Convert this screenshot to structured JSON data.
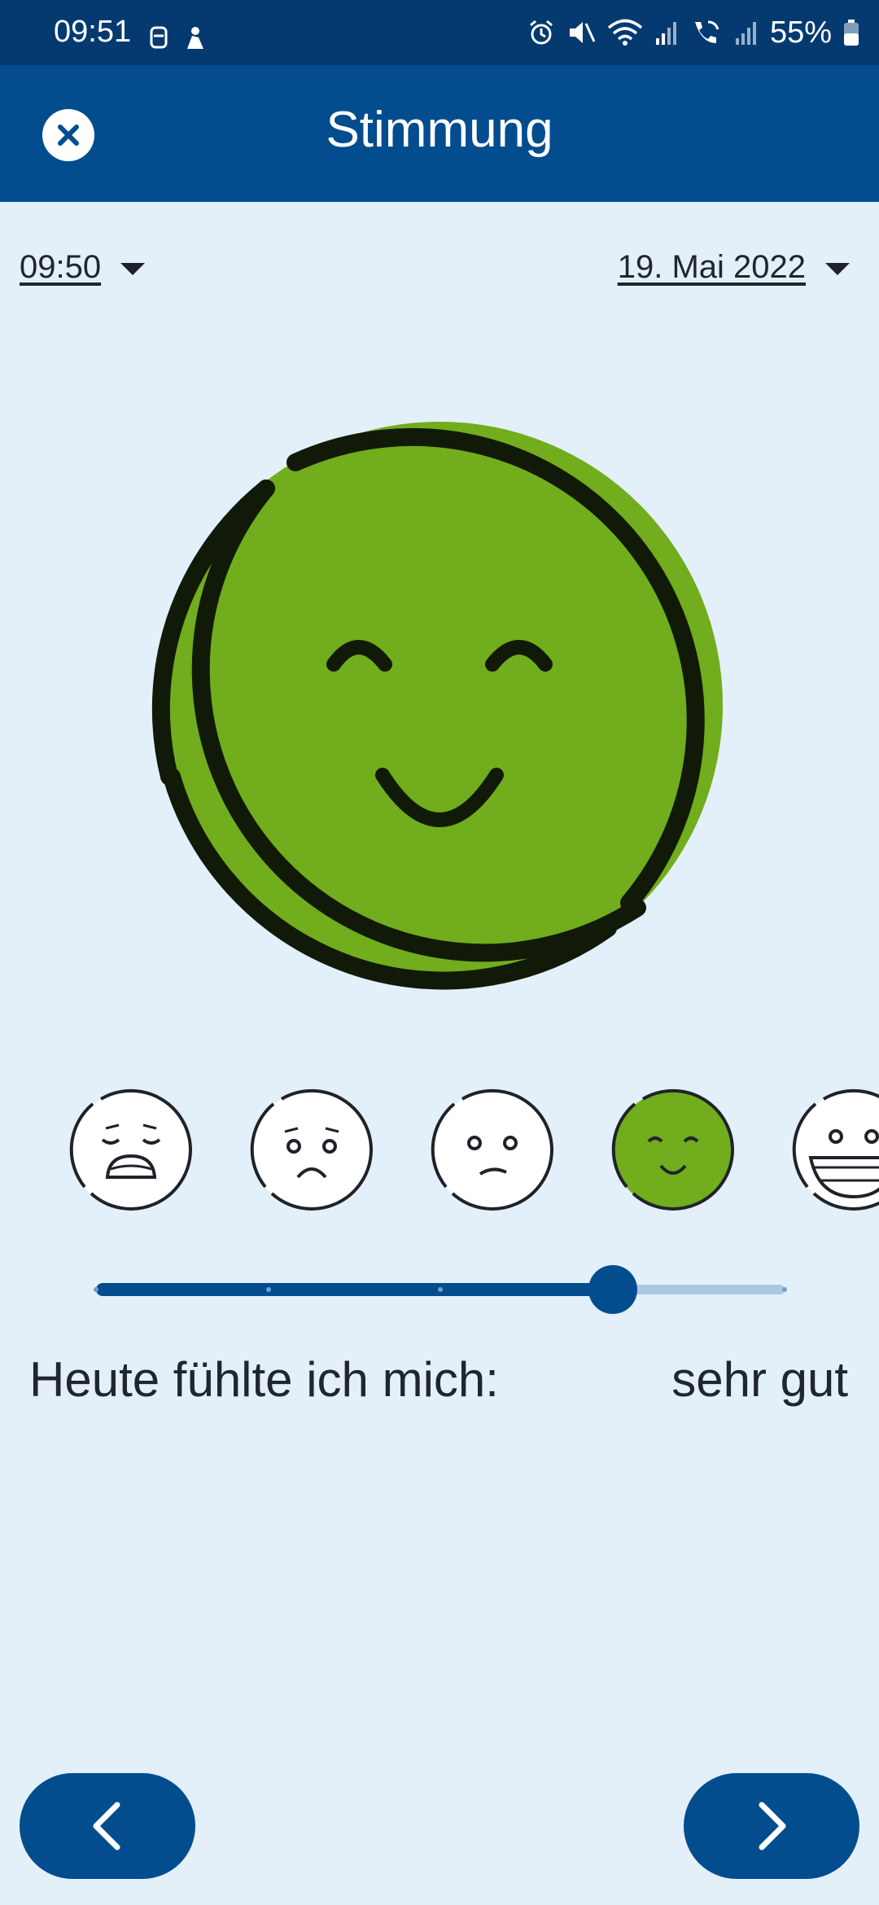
{
  "status_bar": {
    "time": "09:51",
    "battery_percent": "55%",
    "icons": [
      "alarm-icon",
      "mute-icon",
      "wifi-icon",
      "signal-icon",
      "wifi-calling-icon",
      "signal-icon",
      "battery-icon"
    ]
  },
  "header": {
    "title": "Stimmung",
    "close_icon": "close-icon"
  },
  "entry": {
    "time": "09:50",
    "date": "19. Mai 2022"
  },
  "mood": {
    "options": [
      "anguished-face",
      "sad-face",
      "neutral-face",
      "smiling-face",
      "grinning-face"
    ],
    "selected_index": 3,
    "slider_fraction": 0.75,
    "caption": "Heute fühlte ich mich:",
    "value_label": "sehr gut"
  },
  "colors": {
    "accent": "#034d8f",
    "mood_green": "#71ad1c",
    "background": "#e3eff9"
  },
  "nav": {
    "prev_icon": "chevron-left-icon",
    "next_icon": "chevron-right-icon"
  }
}
